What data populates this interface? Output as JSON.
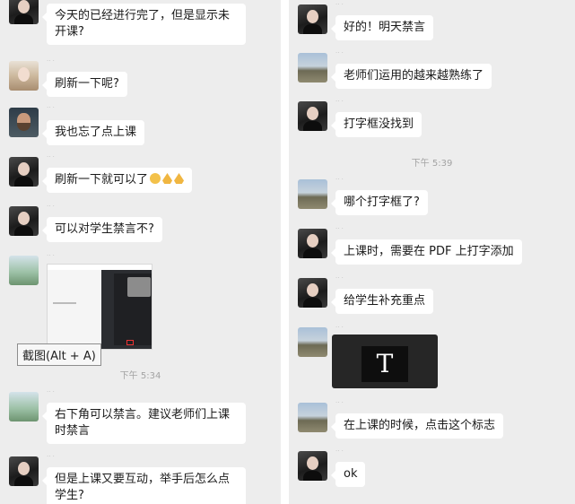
{
  "left": {
    "messages": [
      {
        "avatar": "dark-portrait",
        "text": "今天的已经进行完了，但是显示未开课?"
      },
      {
        "avatar": "blonde-portrait",
        "text": "刷新一下呢?"
      },
      {
        "avatar": "man-portrait",
        "text": "我也忘了点上课"
      },
      {
        "avatar": "dark-portrait",
        "text": "刷新一下就可以了",
        "emojis": [
          "smile-emoji",
          "clap-emoji",
          "clap-emoji"
        ]
      },
      {
        "avatar": "dark-portrait",
        "text": "可以对学生禁言不?"
      },
      {
        "avatar": "tree-landscape"
      },
      {
        "avatar": "tree-landscape",
        "text": "右下角可以禁言。建议老师们上课时禁言"
      },
      {
        "avatar": "dark-portrait",
        "text": "但是上课又要互动，举手后怎么点学生?"
      }
    ],
    "tooltip": "截图(Alt + A)",
    "time": "下午 5:34"
  },
  "right": {
    "messages": [
      {
        "avatar": "dark-portrait",
        "text": "好的！明天禁言"
      },
      {
        "avatar": "landscape",
        "text": "老师们运用的越来越熟练了"
      },
      {
        "avatar": "dark-portrait",
        "text": "打字框没找到"
      },
      {
        "avatar": "landscape",
        "text": "哪个打字框了?"
      },
      {
        "avatar": "dark-portrait",
        "text": "上课时，需要在 PDF 上打字添加"
      },
      {
        "avatar": "dark-portrait",
        "text": "给学生补充重点"
      },
      {
        "avatar": "landscape"
      },
      {
        "avatar": "landscape",
        "text": "在上课的时候，点击这个标志"
      },
      {
        "avatar": "dark-portrait",
        "text": "ok"
      }
    ],
    "time": "下午 5:39",
    "text_tool_glyph": "T"
  }
}
